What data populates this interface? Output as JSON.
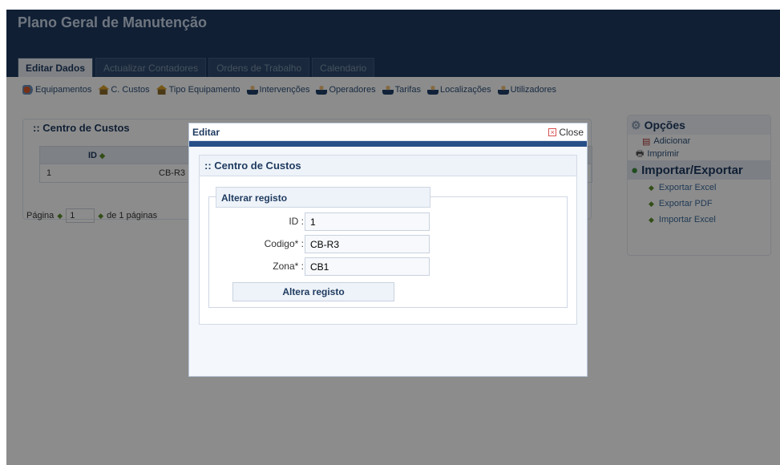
{
  "app": {
    "title": "Plano Geral de Manutenção"
  },
  "tabs": [
    {
      "label": "Editar Dados",
      "active": true
    },
    {
      "label": "Actualizar Contadores"
    },
    {
      "label": "Ordens de Trabalho"
    },
    {
      "label": "Calendario"
    }
  ],
  "toolbar": {
    "items": [
      {
        "label": "Equipamentos",
        "icon": "gear-icon"
      },
      {
        "label": "C. Custos",
        "icon": "house-icon"
      },
      {
        "label": "Tipo Equipamento",
        "icon": "house-icon"
      },
      {
        "label": "Intervenções",
        "icon": "user-icon"
      },
      {
        "label": "Operadores",
        "icon": "user-icon"
      },
      {
        "label": "Tarifas",
        "icon": "user-icon"
      },
      {
        "label": "Localizações",
        "icon": "user-icon"
      },
      {
        "label": "Utilizadores",
        "icon": "user-icon"
      }
    ]
  },
  "panel": {
    "title": ":: Centro de Custos",
    "columns": [
      "ID"
    ],
    "rows": [
      {
        "id": "1",
        "code": "CB-R3"
      }
    ],
    "pager": {
      "label": "Página",
      "page": "1",
      "of": "de 1 páginas"
    }
  },
  "side": {
    "options_title": "Opções",
    "options": [
      "Adicionar",
      "Imprimir"
    ],
    "io_title": "Importar/Exportar",
    "io": [
      "Exportar Excel",
      "Exportar PDF",
      "Importar Excel"
    ]
  },
  "modal": {
    "title": "Editar",
    "close_label": "Close",
    "box_title": ":: Centro de Custos",
    "legend": "Alterar registo",
    "fields": [
      {
        "label": "ID :",
        "value": "1"
      },
      {
        "label": "Codigo* :",
        "value": "CB-R3"
      },
      {
        "label": "Zona* :",
        "value": "CB1"
      }
    ],
    "submit_label": "Altera registo"
  },
  "colors": {
    "header": "#1e3a5f",
    "accent": "#274f87",
    "link": "#2c4f78"
  }
}
